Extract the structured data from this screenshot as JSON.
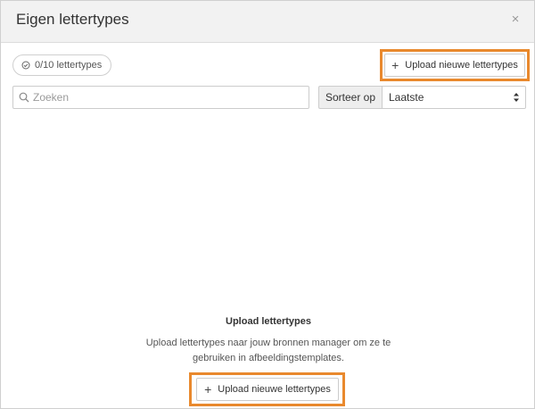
{
  "modal": {
    "title": "Eigen lettertypes",
    "close_label": "×"
  },
  "toolbar": {
    "font_count": "0/10 lettertypes",
    "upload_label": "Upload nieuwe lettertypes"
  },
  "search": {
    "placeholder": "Zoeken",
    "value": ""
  },
  "sort": {
    "label": "Sorteer op",
    "selected": "Laatste"
  },
  "empty_state": {
    "title": "Upload lettertypes",
    "description": "Upload lettertypes naar jouw bronnen manager om ze te gebruiken in afbeeldingstemplates.",
    "upload_label": "Upload nieuwe lettertypes"
  },
  "colors": {
    "highlight": "#e9892d",
    "header_bg": "#f2f2f2",
    "border": "#cccccc"
  },
  "icons": {
    "count": "check-circle-icon",
    "search": "search-icon",
    "upload": "plus-icon",
    "sort": "sort-arrows-icon",
    "close": "close-icon"
  }
}
